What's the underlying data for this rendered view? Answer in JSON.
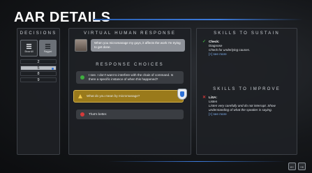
{
  "page_title": "AAR DETAILS",
  "decisions": {
    "title": "DECISIONS",
    "icons": [
      {
        "label": "Show All",
        "icon": "list-icon"
      },
      {
        "label": "Flagged",
        "icon": "flag-icon"
      }
    ],
    "items": [
      {
        "label": "2"
      },
      {
        "label": "5"
      },
      {
        "label": "8"
      },
      {
        "label": "9"
      }
    ]
  },
  "vh": {
    "title": "VIRTUAL HUMAN RESPONSE",
    "text": "When you micromanage my guys, it affects the work I'm trying to get done."
  },
  "choices": {
    "title": "RESPONSE CHOICES",
    "items": [
      {
        "text": "I see. I don't want to interfere with the chain of command. Is there a specific instance of when this happened?",
        "status": "good",
        "color": "#3fae3f"
      },
      {
        "text": "What do you mean by micromanage?",
        "status": "selected",
        "color": "#f2c84a"
      },
      {
        "text": "That's better.",
        "status": "bad",
        "color": "#d33a3a"
      }
    ]
  },
  "skills": {
    "sustain_title": "SKILLS TO SUSTAIN",
    "sustain": {
      "name": "Check:",
      "line1": "Diagnose",
      "line2": "Check for underlying causes.",
      "more": "[+] see more"
    },
    "improve_title": "SKILLS TO IMPROVE",
    "improve": {
      "name": "LiSA:",
      "line1": "Listen",
      "line2": "Listen very carefully and do not interrupt. Show understanding of what the speaker is saying.",
      "more": "[+] see more"
    }
  },
  "nav": {
    "back": "←",
    "forward": "→"
  },
  "colors": {
    "accent": "#3c7bdc",
    "good": "#3fae3f",
    "bad": "#d33a3a",
    "selected_bg": "#9a7a1b"
  }
}
